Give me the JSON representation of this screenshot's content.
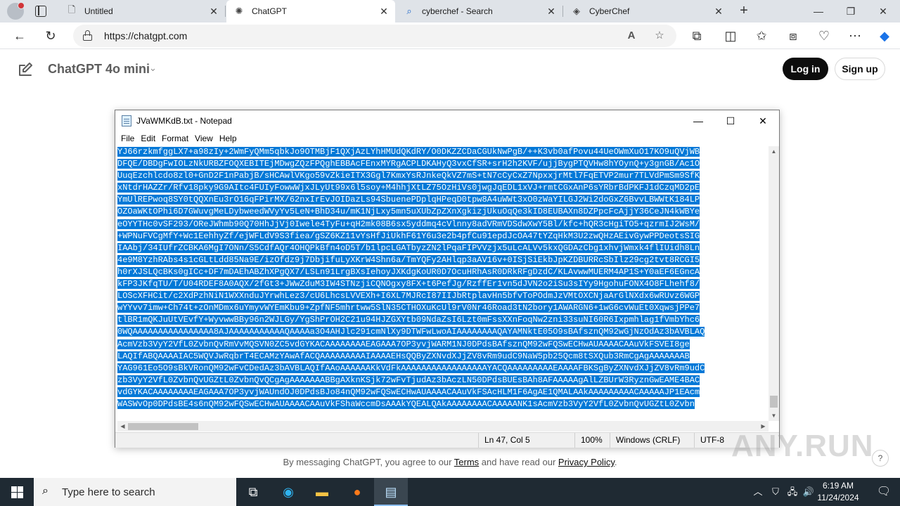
{
  "browser": {
    "tabs": [
      {
        "title": "Untitled",
        "icon": "document-icon"
      },
      {
        "title": "ChatGPT",
        "icon": "chatgpt-icon"
      },
      {
        "title": "cyberchef - Search",
        "icon": "search-icon"
      },
      {
        "title": "CyberChef",
        "icon": "cyberchef-icon"
      }
    ],
    "active_tab": 1,
    "url": "https://chatgpt.com"
  },
  "chatgpt": {
    "model_title": "ChatGPT 4o mini",
    "login_label": "Log in",
    "signup_label": "Sign up",
    "footer_prefix": "By messaging ChatGPT, you agree to our ",
    "footer_terms": "Terms",
    "footer_middle": " and have read our ",
    "footer_privacy": "Privacy Policy",
    "footer_suffix": ".",
    "help_label": "?"
  },
  "notepad": {
    "title": "JVaWMKdB.txt - Notepad",
    "menu": [
      "File",
      "Edit",
      "Format",
      "View",
      "Help"
    ],
    "lines": [
      "YJ66rzkmfggLX7+a98zIy+2WmFyQMm5qbkJo9OTMBjF1QXjAzLYhHMUdQKdRY/O0DKZZCDaCGUkNwPgB/++K3vb0afPovu44UeOWmXuO17KO9uQVjWB",
      "DFQE/DBDgFwIOLzNkURBZFOQXEBITEjMDwgZQzFPQghEBBAcFEnxMYRgACPLDKAHyQ3vxCfSR+srH2h2KVF/ujjBygPTQVHw8hYOynQ+y3gnGB/Ac1O",
      "UuqEzchlcdo8zl0+GnD2F1nPabjB/sHCAwlVKgo59vZkieITX3Ggl7KmxYsRJnkeQkVZ7mS+tN7cCyCxZ7NpxxjrMtl7FqETVP2mur7TLVdPmSm9SfK",
      "xNtdrHAZZr/Rfv18pky9G9AItc4FUIyFowwWjxJLyUt99x6l5soy+M4hhjXtLZ75OzHiVs0jwgJqEDL1xVJ+rmtCGxAnP6sYRbrBdPKFJ1dCzqMD2pE",
      "YmUlREPwoq8SY0tQQXnEu3rO16qFPirMX/62nxIrEvJOIDazLs94SbuenePDplqHPeqD0tpw8A4uWWt3xO0zWaYILGJ2Wi2doGxZ6BvvLBWWtK184LP",
      "OZOaWKtOPhi6D7GWuvgMeLDybweedWVyYv5LeN+BhD34u/mK1NjLxy5mn5uXUbZpZXnXgkizjUkuOqQe3kID8EUBAXn8DZPpcFcAjjY36CeJN4kWBYe",
      "eOYYTHc0vSF293/OReJWhmb90Q70HhJjVj0Iwele4TyFu+qH2mk08B6sx5yddmq4cVlnny8adVRmVDSdwXwY5Bl/kfc+hQR3cHgiTO5+qzrmIJ2WsM/",
      "+WPNuFVCgMfY+Wc1EehhyZf/ejWFLdV9S3fiea/gSZ6KZ11vYsHfJiUkhF61Y6u3e2b4pfCu91epdJcOA47tYZqHkM3U2zwQHzAEivGywPPDeotsSIG",
      "IAAbj/34IUfrZCBKA6MgI7ONn/S5CdfAQr4OHQPkBfn4oD5T/b1lpcLGATbyzZN2lPqaFIPVVzjx5uLcALVv5kxQGDAzCbg1xhvjWmxk4flIUidh8Ln",
      "4e9M8YzhRAbs4s1cGLtLdd85Na9E/izOfdz9j7DbjifuLyXKrW4Shn6a/TmYQFy2AHlqp3aAV16v+0ISjSiEkbJpKZDBURRcSbIlz29cg2tvt8RCGI5",
      "h0rXJSLQcBKs0gICc+DF7mDAEhABZhXPgQX7/LSLn91LrgBXsIehoyJXKdgKoUR0D7OcuHRhAsR0DRkRFgDzdC/KLAvwwMUERM4AP1S+Y0aEF6EGncA",
      "kFP3JKfqTU/T/U04RDEF8A0AQX/2fGt3+JWwZduM3IW4STNzjiCQNOgxy8FX+t6PefJg/RzffEr1vn5dJVN2o2iSu3sIYy9HgohuFONX4O8FLhehf8/",
      "LOScXFHCit/c2XdPzhNiN1WXXnduJYrwhLez3/cU6LhcsLVVEXh+I6XL7MJRcI87IIJbRtplavHn5bfvToPOdmJzVMtOXCNjaArGlNXdx6wRUvz6WGP",
      "wYYvv7imw+Ch74t+zOnMDmx6uYmyvWYEmKbu9+ZpfNF5mhrtww5SlN35CTHOXuKcUl9rV0Nr46Road3tN2bory1AWARGN6+1wG6cvWuEt0XqwsjPPe7",
      "tlBR1mQKJuUtVEvfY+WyvwwBBy96n2WJLGy/YgShPrOH2C21u94HJZGXYtb09NdaZsI6Lzt0mFssXXnFoqNw2zni33suNI60R6Ixpmhlag1fVmbYhc6",
      "0WQAAAAAAAAAAAAAAAA8AJAAAAAAAAAAAQAAAAa3O4AHJlc291cmNlXy9DTWFwLwoAIAAAAAAAAQAYAMNktE05O9sBAfsznQM92wGjNzOdAz3bAVBLAQ",
      "AcmVzb3VyY2VfL0ZvbnQvRmVvMQSVN0ZC5vdGYKACAAAAAAAAEAGAAA7OP3yvjWARM1NJ0DPdsBAfsznQM92wFQSwECHwAUAAAACAAuVkFSVEI8ge",
      "LAQIfABQAAAAIAC5WQVJwRqbrT4ECAMzYAwAfACQAAAAAAAAAIAAAAEHsQQByZXNvdXJjZV8vRm9udC9NaW5pb25Qcm8tSXQub3RmCgAgAAAAAAAB",
      "YAG961Eo5O9sBkVRonQM92wFvCDedAz3bAVBLAQIfAAoAAAAAAKkVdFkAAAAAAAAAAAAAAAAAYACQAAAAAAAAAEAAAAFBKSgByZXNvdXJjZV8vRm9udC",
      "zb3VyY2VfL0ZvbnQvUGZtL0ZvbnQvQCgAgAAAAAAABBgAXknKSjk72wFvTjudAz3bAczLN50DPdsBUEsBAh8AFAAAAAgAlLZBUrW3RyznGwEAME4BAC",
      "vdGYKACAAAAAAAAEAGAAA7OP3yvjWAUndOJ0DPdsBJo84nQM92wFQSwECHwAUAAAACAAuVkFSAcHLM1F6AgAE1QMALAAkAAAAAAAAACAAAAAJP1EAcm",
      "WASWvOp0DPdsBE4s6nQM92wFQSwECHwAUAAAACAAuVkFShaWccmDsAAAkYQEALQAkAAAAAAAACAAAAANK1sAcmVzb3VyY2VfL0ZvbnQvUGZtL0Zvbn"
    ],
    "status": {
      "position": "Ln 47, Col 5",
      "zoom": "100%",
      "line_ending": "Windows (CRLF)",
      "encoding": "UTF-8"
    }
  },
  "watermark": "ANY.RUN",
  "taskbar": {
    "search_placeholder": "Type here to search",
    "time": "6:19 AM",
    "date": "11/24/2024"
  }
}
